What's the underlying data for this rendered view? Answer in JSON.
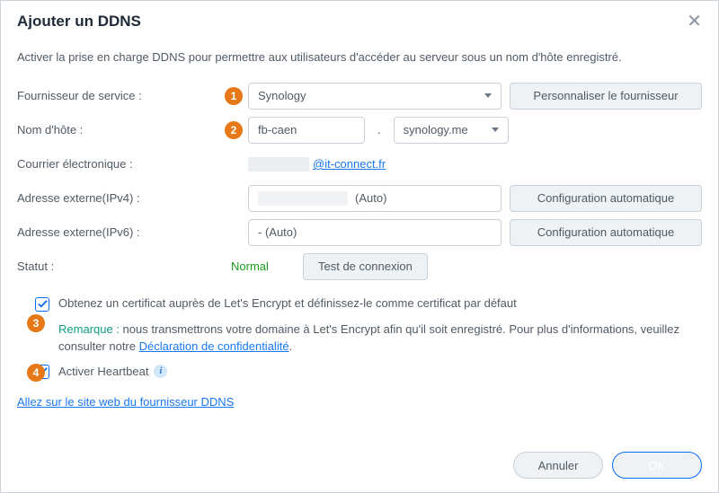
{
  "dialog": {
    "title": "Ajouter un DDNS",
    "intro": "Activer la prise en charge DDNS pour permettre aux utilisateurs d'accéder au serveur sous un nom d'hôte enregistré."
  },
  "badges": {
    "b1": "1",
    "b2": "2",
    "b3": "3",
    "b4": "4"
  },
  "labels": {
    "provider": "Fournisseur de service :",
    "hostname": "Nom d'hôte :",
    "email": "Courrier électronique :",
    "ipv4": "Adresse externe(IPv4) :",
    "ipv6": "Adresse externe(IPv6) :",
    "status": "Statut :"
  },
  "values": {
    "provider": "Synology",
    "hostname": "fb-caen",
    "domain": "synology.me",
    "email_suffix": "@it-connect.fr",
    "ipv4_suffix": "(Auto)",
    "ipv6": "- (Auto)",
    "status": "Normal"
  },
  "buttons": {
    "customize_provider": "Personnaliser le fournisseur",
    "auto_config": "Configuration automatique",
    "test_conn": "Test de connexion",
    "cancel": "Annuler",
    "ok": "OK"
  },
  "checks": {
    "le_cert": "Obtenez un certificat auprès de Let's Encrypt et définissez-le comme certificat par défaut",
    "heartbeat": "Activer Heartbeat"
  },
  "note": {
    "label": "Remarque :",
    "text_before": " nous transmettrons votre domaine à Let's Encrypt afin qu'il soit enregistré. Pour plus d'informations, veuillez consulter notre ",
    "link": "Déclaration de confidentialité",
    "text_after": "."
  },
  "links": {
    "provider_site": "Allez sur le site web du fournisseur DDNS"
  }
}
